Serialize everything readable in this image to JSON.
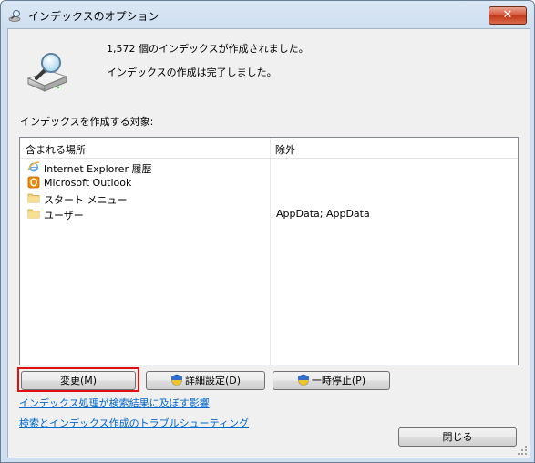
{
  "window": {
    "title": "インデックスのオプション",
    "close_label": "✕"
  },
  "status": {
    "count_message": "1,572 個のインデックスが作成されました。",
    "complete_message": "インデックスの作成は完了しました。"
  },
  "section_label": "インデックスを作成する対象:",
  "list": {
    "columns": [
      "含まれる場所",
      "除外"
    ],
    "rows": [
      {
        "icon": "internet-explorer-icon",
        "label": "Internet Explorer 履歴",
        "exclude": ""
      },
      {
        "icon": "outlook-icon",
        "label": "Microsoft Outlook",
        "exclude": ""
      },
      {
        "icon": "folder-icon",
        "label": "スタート メニュー",
        "exclude": ""
      },
      {
        "icon": "folder-icon",
        "label": "ユーザー",
        "exclude": "AppData; AppData"
      }
    ]
  },
  "buttons": {
    "change": "変更(M)",
    "advanced": "詳細設定(D)",
    "pause": "一時停止(P)",
    "close": "閉じる"
  },
  "links": {
    "effect": "インデックス処理が検索結果に及ぼす影響",
    "troubleshoot": "検索とインデックス作成のトラブルシューティング"
  },
  "colors": {
    "link": "#0066cc",
    "highlight_border": "#e01010"
  }
}
